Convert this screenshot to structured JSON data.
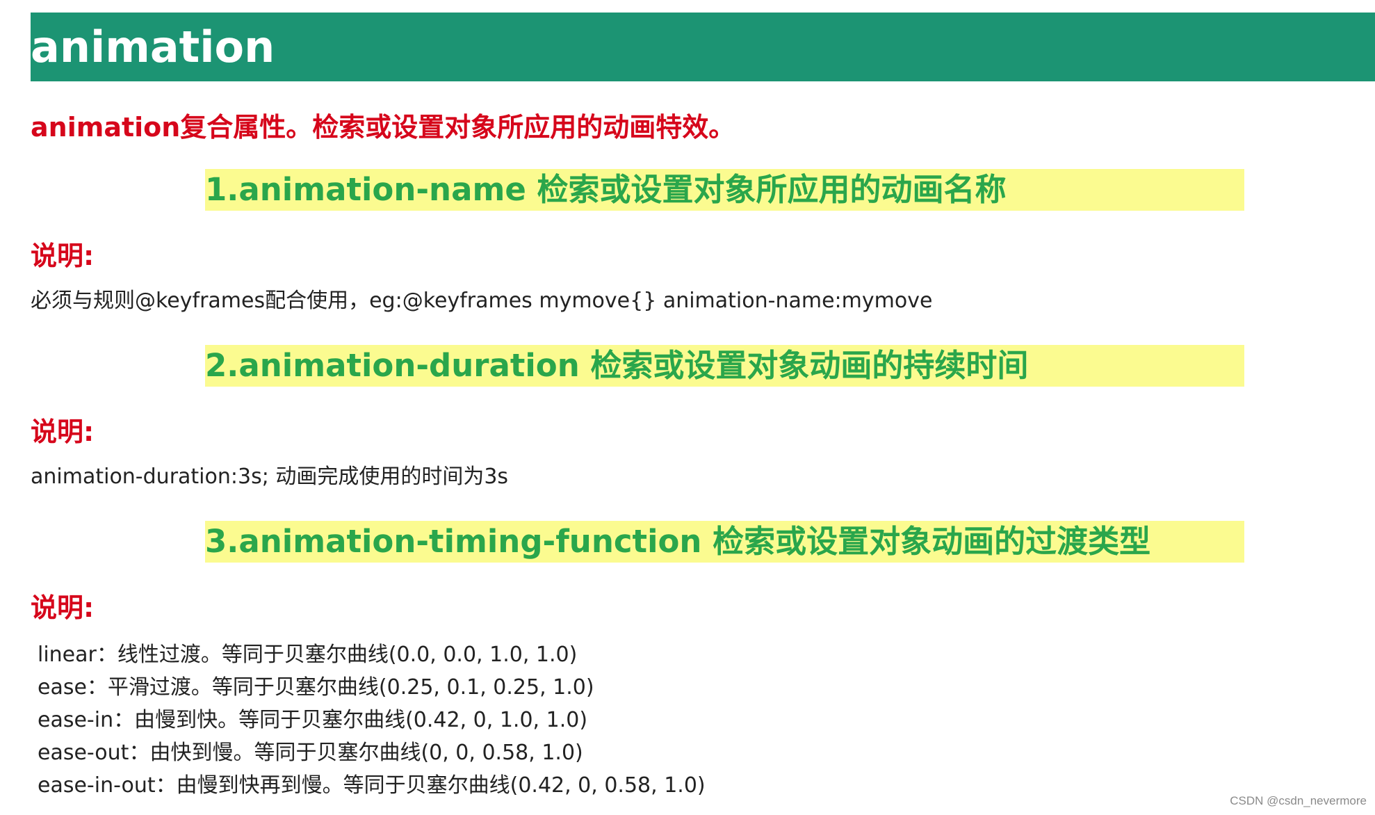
{
  "header": {
    "title": "animation"
  },
  "intro": "animation复合属性。检索或设置对象所应用的动画特效。",
  "sections": [
    {
      "heading": "1.animation-name  检索或设置对象所应用的动画名称",
      "note_label": "说明:",
      "text": "必须与规则@keyframes配合使用，eg:@keyframes mymove{}  animation-name:mymove"
    },
    {
      "heading": "2.animation-duration  检索或设置对象动画的持续时间",
      "note_label": "说明:",
      "text": "animation-duration:3s;    动画完成使用的时间为3s"
    },
    {
      "heading": "3.animation-timing-function  检索或设置对象动画的过渡类型",
      "note_label": "说明:",
      "items": [
        "linear：线性过渡。等同于贝塞尔曲线(0.0, 0.0, 1.0, 1.0)",
        "ease：平滑过渡。等同于贝塞尔曲线(0.25, 0.1, 0.25, 1.0)",
        "ease-in：由慢到快。等同于贝塞尔曲线(0.42, 0, 1.0, 1.0)",
        "ease-out：由快到慢。等同于贝塞尔曲线(0, 0, 0.58, 1.0)",
        "ease-in-out：由慢到快再到慢。等同于贝塞尔曲线(0.42, 0, 0.58, 1.0)"
      ]
    }
  ],
  "watermark": "CSDN @csdn_nevermore",
  "colors": {
    "header_bg": "#1c9473",
    "intro_text": "#d6061b",
    "heading_band": "#fbfb90",
    "heading_text": "#2aa64b"
  }
}
